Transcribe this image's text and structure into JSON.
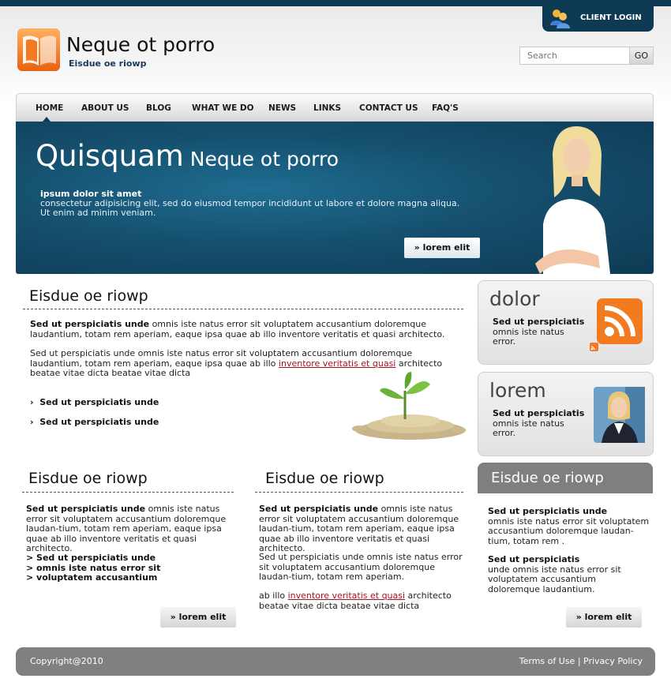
{
  "header": {
    "client_login": "CLIENT LOGIN",
    "site_title": "Neque ot porro",
    "tagline": "Eisdue oe riowp",
    "search_placeholder": "Search",
    "search_go": "GO"
  },
  "nav": {
    "items": [
      "HOME",
      "ABOUT US",
      "BLOG",
      "WHAT WE DO",
      "NEWS",
      "LINKS",
      "CONTACT US",
      "FAQ'S"
    ]
  },
  "hero": {
    "title_big": "Quisquam",
    "title_small": "Neque ot porro",
    "subtitle": "ipsum dolor sit amet",
    "text": "consectetur adipisicing elit, sed do eiusmod tempor incididunt ut labore et dolore magna aliqua. Ut enim ad minim veniam.",
    "button": "lorem elit"
  },
  "main": {
    "heading": "Eisdue oe riowp",
    "p1_bold": "Sed ut perspiciatis unde",
    "p1_rest": " omnis iste natus error sit voluptatem accusantium doloremque laudantium, totam rem aperiam, eaque ipsa quae ab illo inventore veritatis et quasi architecto.",
    "p2_before": "Sed ut perspiciatis unde omnis iste natus error sit voluptatem accusantium doloremque laudantium, totam rem aperiam, eaque ipsa quae ab illo ",
    "p2_link": "inventore veritatis et quasi",
    "p2_after": " architecto beatae vitae dicta  beatae vitae dicta",
    "bullets": [
      "Sed ut perspiciatis unde",
      "Sed ut perspiciatis unde"
    ]
  },
  "side_boxes": [
    {
      "title": "dolor",
      "bold": "Sed ut perspiciatis",
      "text": "omnis iste natus error."
    },
    {
      "title": "lorem",
      "bold": "Sed ut perspiciatis",
      "text": "omnis iste natus error."
    }
  ],
  "col1": {
    "heading": "Eisdue oe riowp",
    "p_bold": "Sed ut perspiciatis unde",
    "p_rest": " omnis iste natus error sit voluptatem accusantium doloremque laudan-tium, totam rem aperiam, eaque ipsa quae ab illo inventore veritatis et quasi architecto.",
    "list": [
      "> Sed ut perspiciatis unde",
      "> omnis iste natus error sit",
      "> voluptatem accusantium"
    ],
    "button": "lorem elit"
  },
  "col2": {
    "heading": "Eisdue oe riowp",
    "p1_bold": "Sed ut perspiciatis unde",
    "p1_rest": " omnis iste natus error sit voluptatem accusantium doloremque laudan-tium, totam rem aperiam, eaque ipsa quae ab illo inventore veritatis et quasi architecto.",
    "p2": "Sed ut perspiciatis unde omnis iste natus error sit voluptatem accusantium doloremque laudan-tium, totam rem aperiam.",
    "p3_before": "ab illo ",
    "p3_link": "inventore veritatis et quasi",
    "p3_after": " architecto beatae vitae dicta  beatae vitae dicta"
  },
  "col3": {
    "heading": "Eisdue oe riowp",
    "p1_bold": "Sed ut perspiciatis unde",
    "p1_rest": "omnis iste natus error sit voluptatem accusantium doloremque laudan-tium, totam rem .",
    "p2_bold": "Sed ut perspiciatis",
    "p2_rest": "unde omnis iste natus error sit voluptatem accusantium doloremque laudantium.",
    "button": "lorem elit"
  },
  "footer": {
    "copyright": "Copyright@2010",
    "terms": "Terms of Use",
    "separator": "|",
    "privacy": "Privacy Policy"
  },
  "colors": {
    "brand_dark": "#0e3a54",
    "accent_orange": "#f47a1f",
    "link_red": "#a5141e",
    "footer_grey": "#808080"
  },
  "icons": [
    "users-icon",
    "book-logo-icon",
    "rss-icon",
    "person-photo",
    "coins-plant-image",
    "double-chevron-icon"
  ]
}
